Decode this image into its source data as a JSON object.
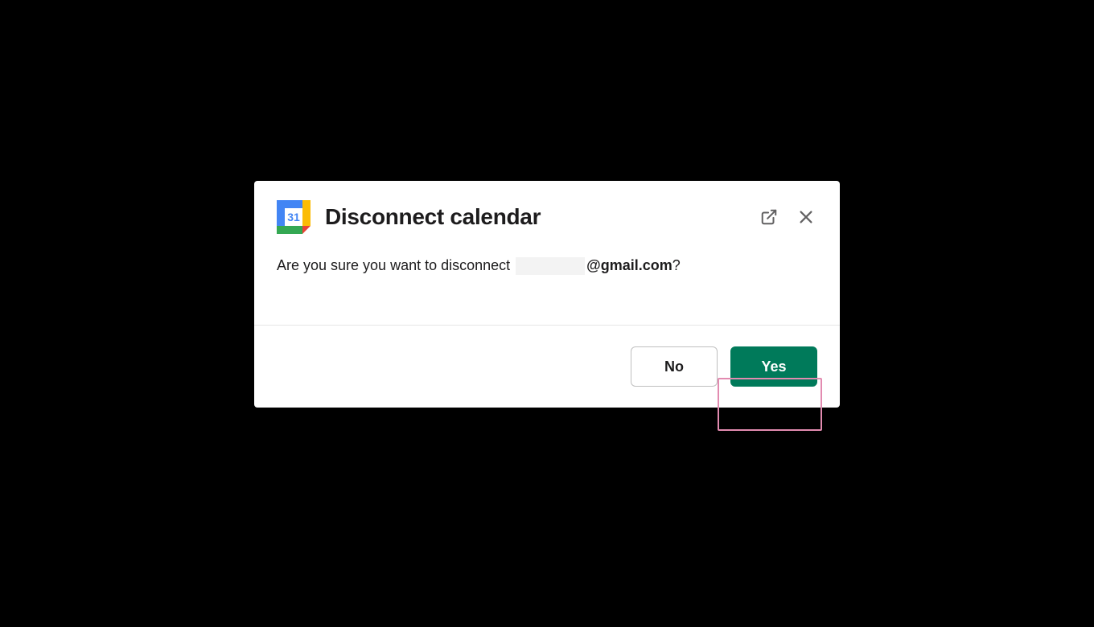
{
  "modal": {
    "title": "Disconnect calendar",
    "body_prefix": "Are you sure you want to disconnect ",
    "email_domain": "@gmail.com",
    "question_mark": "?",
    "buttons": {
      "no": "No",
      "yes": "Yes"
    }
  },
  "icons": {
    "calendar_day": "31"
  },
  "colors": {
    "primary_button": "#007a5a",
    "highlight_border": "#e28bb0"
  }
}
